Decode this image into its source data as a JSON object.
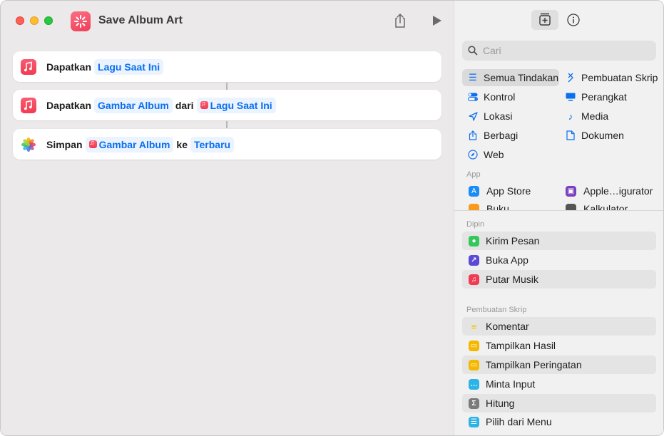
{
  "window": {
    "title": "Save Album Art"
  },
  "actions": [
    {
      "verb": "Dapatkan",
      "tokens": [
        "Lagu Saat Ini"
      ]
    },
    {
      "verb": "Dapatkan",
      "token1": "Gambar Album",
      "joiner": "dari",
      "token2": "Lagu Saat Ini"
    },
    {
      "verb": "Simpan",
      "token1": "Gambar Album",
      "joiner": "ke",
      "token2": "Terbaru"
    }
  ],
  "sidebar": {
    "search_placeholder": "Cari",
    "categories_left": [
      "Semua Tindakan",
      "Kontrol",
      "Lokasi",
      "Berbagi",
      "Web"
    ],
    "categories_right": [
      "Pembuatan Skrip",
      "Perangkat",
      "Media",
      "Dokumen"
    ],
    "apps_header": "App",
    "apps": [
      "App Store",
      "Apple…igurator",
      "Buku",
      "Kalkulator"
    ],
    "pinned_header": "Dipin",
    "pinned": [
      "Kirim Pesan",
      "Buka App",
      "Putar Musik"
    ],
    "scripting_header": "Pembuatan Skrip",
    "scripting": [
      "Komentar",
      "Tampilkan Hasil",
      "Tampilkan Peringatan",
      "Minta Input",
      "Hitung",
      "Pilih dari Menu"
    ]
  },
  "colors": {
    "accent": "#0a6ff0",
    "token_bg": "#eaf3fe",
    "music": "#f13b53"
  }
}
